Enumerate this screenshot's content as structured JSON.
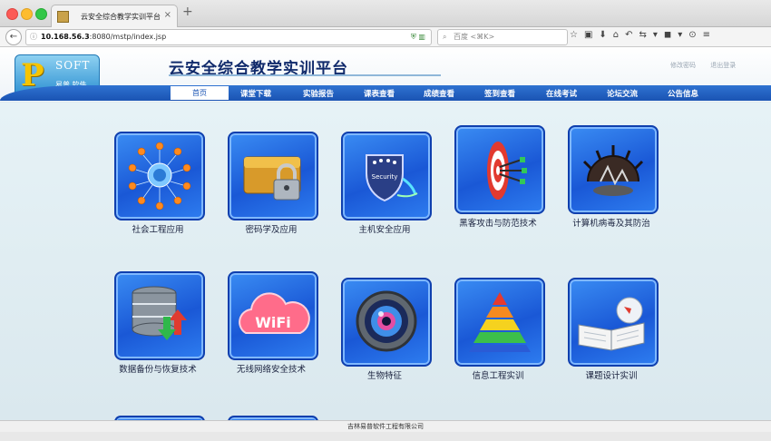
{
  "browser": {
    "tab_title": "云安全综合教学实训平台",
    "tab_close": "×",
    "new_tab": "+",
    "url_host": "10.168.56.3",
    "url_rest": ":8080/mstp/index.jsp",
    "search_placeholder": "百度 <⌘K>"
  },
  "header": {
    "logo_letter": "P",
    "logo_soft": "SOFT",
    "logo_cn": "易普 软件",
    "title": "云安全综合教学实训平台",
    "links": [
      "修改密码",
      "退出登录"
    ]
  },
  "menu": [
    "首页",
    "课堂下载",
    "实验报告",
    "课表查看",
    "成绩查看",
    "签到查看",
    "在线考试",
    "论坛交流",
    "公告信息"
  ],
  "apps": [
    {
      "label": "社会工程应用",
      "icon": "social-engineering-icon"
    },
    {
      "label": "密码学及应用",
      "icon": "padlock-wallet-icon"
    },
    {
      "label": "主机安全应用",
      "icon": "security-shield-icon"
    },
    {
      "label": "黑客攻击与防范技术",
      "icon": "target-darts-icon"
    },
    {
      "label": "计算机病毒及其防治",
      "icon": "virus-icon"
    },
    {
      "label": "数据备份与恢复技术",
      "icon": "database-backup-icon"
    },
    {
      "label": "无线网络安全技术",
      "icon": "wifi-cloud-icon"
    },
    {
      "label": "生物特征",
      "icon": "iris-icon"
    },
    {
      "label": "信息工程实训",
      "icon": "pyramid-icon"
    },
    {
      "label": "课题设计实训",
      "icon": "book-globe-icon"
    }
  ],
  "wifi_text": "WiFi",
  "shield_text": "Security",
  "footer": "吉林易普软件工程有限公司",
  "colors": {
    "menu_blue": "#1a53b3",
    "tile_blue": "#1a58d6",
    "title_navy": "#102a6b"
  }
}
